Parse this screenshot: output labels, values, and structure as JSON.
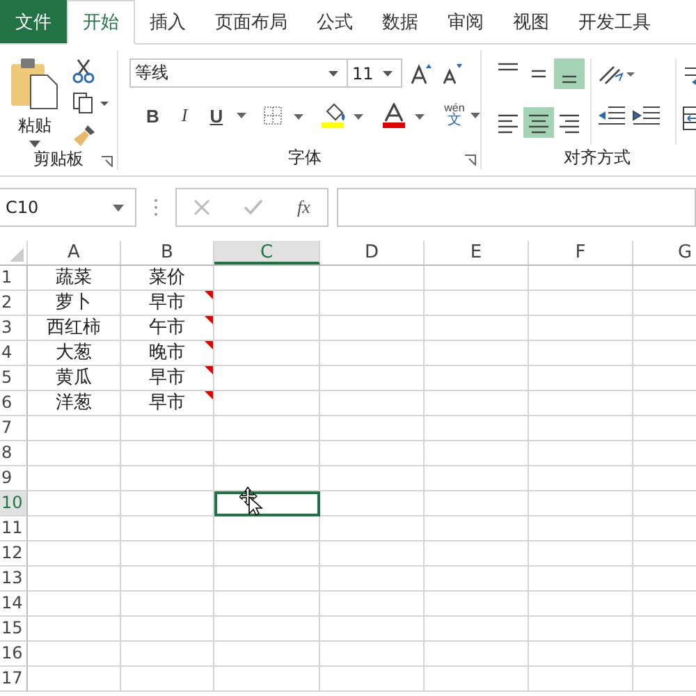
{
  "tabs": [
    {
      "label": "文件",
      "kind": "file",
      "selected": false
    },
    {
      "label": "开始",
      "kind": "tab",
      "selected": true
    },
    {
      "label": "插入",
      "kind": "tab",
      "selected": false
    },
    {
      "label": "页面布局",
      "kind": "tab",
      "selected": false
    },
    {
      "label": "公式",
      "kind": "tab",
      "selected": false
    },
    {
      "label": "数据",
      "kind": "tab",
      "selected": false
    },
    {
      "label": "审阅",
      "kind": "tab",
      "selected": false
    },
    {
      "label": "视图",
      "kind": "tab",
      "selected": false
    },
    {
      "label": "开发工具",
      "kind": "tab",
      "selected": false
    }
  ],
  "clipboard": {
    "paste_label": "粘贴",
    "group_label": "剪贴板"
  },
  "font": {
    "font_name": "等线",
    "font_size": "11",
    "bold": "B",
    "italic": "I",
    "underline": "U",
    "phonetic_top": "wén",
    "phonetic_bottom": "文",
    "group_label": "字体"
  },
  "alignment": {
    "buttons": [
      {
        "kind": "top",
        "selected": false
      },
      {
        "kind": "middle",
        "selected": false
      },
      {
        "kind": "bottom",
        "selected": true
      },
      {
        "kind": "left",
        "selected": false
      },
      {
        "kind": "center",
        "selected": true
      },
      {
        "kind": "right",
        "selected": false
      }
    ],
    "group_label": "对齐方式"
  },
  "formula_bar": {
    "name_box": "C10",
    "fx": "fx"
  },
  "columns": [
    {
      "label": "A",
      "selected": false
    },
    {
      "label": "B",
      "selected": false
    },
    {
      "label": "C",
      "selected": true
    },
    {
      "label": "D",
      "selected": false
    },
    {
      "label": "E",
      "selected": false
    },
    {
      "label": "F",
      "selected": false
    },
    {
      "label": "G",
      "selected": false
    }
  ],
  "rows": [
    {
      "label": "1",
      "selected": false,
      "cells": [
        {
          "text": "蔬菜",
          "comment": false
        },
        {
          "text": "菜价",
          "comment": false
        }
      ]
    },
    {
      "label": "2",
      "selected": false,
      "cells": [
        {
          "text": "萝卜",
          "comment": false
        },
        {
          "text": "早市",
          "comment": true
        }
      ]
    },
    {
      "label": "3",
      "selected": false,
      "cells": [
        {
          "text": "西红柿",
          "comment": false
        },
        {
          "text": "午市",
          "comment": true
        }
      ]
    },
    {
      "label": "4",
      "selected": false,
      "cells": [
        {
          "text": "大葱",
          "comment": false
        },
        {
          "text": "晚市",
          "comment": true
        }
      ]
    },
    {
      "label": "5",
      "selected": false,
      "cells": [
        {
          "text": "黄瓜",
          "comment": false
        },
        {
          "text": "早市",
          "comment": true
        }
      ]
    },
    {
      "label": "6",
      "selected": false,
      "cells": [
        {
          "text": "洋葱",
          "comment": false
        },
        {
          "text": "早市",
          "comment": true
        }
      ]
    },
    {
      "label": "7",
      "selected": false,
      "cells": []
    },
    {
      "label": "8",
      "selected": false,
      "cells": []
    },
    {
      "label": "9",
      "selected": false,
      "cells": []
    },
    {
      "label": "10",
      "selected": true,
      "cells": []
    },
    {
      "label": "11",
      "selected": false,
      "cells": []
    },
    {
      "label": "12",
      "selected": false,
      "cells": []
    },
    {
      "label": "13",
      "selected": false,
      "cells": []
    },
    {
      "label": "14",
      "selected": false,
      "cells": []
    },
    {
      "label": "15",
      "selected": false,
      "cells": []
    },
    {
      "label": "16",
      "selected": false,
      "cells": []
    },
    {
      "label": "17",
      "selected": false,
      "cells": []
    }
  ]
}
